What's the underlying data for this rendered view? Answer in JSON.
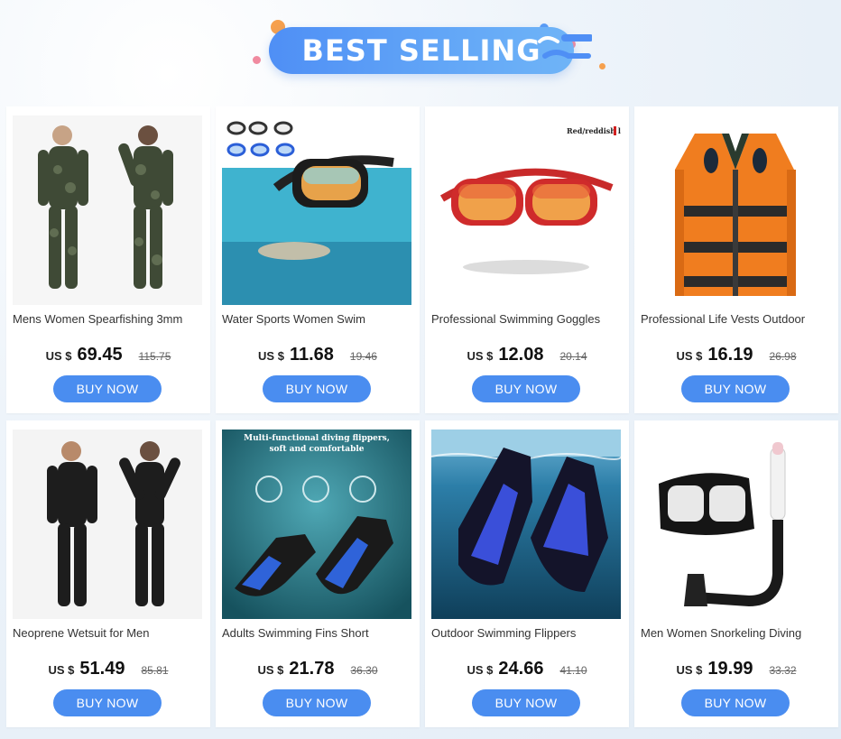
{
  "banner": {
    "title": "BEST SELLING"
  },
  "products": [
    {
      "name": "Mens Women Spearfishing 3mm",
      "currency": "US $",
      "price": "69.45",
      "old_price": "115.75",
      "buy_label": "BUY NOW"
    },
    {
      "name": "Water Sports Women Swim",
      "currency": "US $",
      "price": "11.68",
      "old_price": "19.46",
      "buy_label": "BUY NOW"
    },
    {
      "name": "Professional Swimming Goggles",
      "currency": "US $",
      "price": "12.08",
      "old_price": "20.14",
      "buy_label": "BUY NOW",
      "image_text": "Red/reddish lens"
    },
    {
      "name": "Professional Life Vests Outdoor",
      "currency": "US $",
      "price": "16.19",
      "old_price": "26.98",
      "buy_label": "BUY NOW"
    },
    {
      "name": "Neoprene Wetsuit for Men",
      "currency": "US $",
      "price": "51.49",
      "old_price": "85.81",
      "buy_label": "BUY NOW"
    },
    {
      "name": "Adults Swimming Fins Short",
      "currency": "US $",
      "price": "21.78",
      "old_price": "36.30",
      "buy_label": "BUY NOW",
      "image_text_1": "Multi-functional diving flippers,",
      "image_text_2": "soft and comfortable"
    },
    {
      "name": "Outdoor Swimming Flippers",
      "currency": "US $",
      "price": "24.66",
      "old_price": "41.10",
      "buy_label": "BUY NOW"
    },
    {
      "name": "Men Women Snorkeling Diving",
      "currency": "US $",
      "price": "19.99",
      "old_price": "33.32",
      "buy_label": "BUY NOW"
    }
  ],
  "colors": {
    "accent": "#4a8df0",
    "banner": "#5a9cf6"
  }
}
